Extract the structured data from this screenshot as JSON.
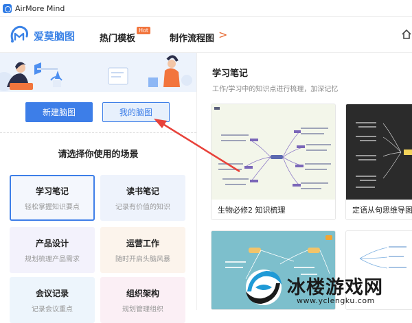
{
  "window": {
    "title": "AirMore Mind"
  },
  "header": {
    "brand": "爱莫脑图",
    "nav": [
      {
        "label": "热门模板",
        "badge": "Hot"
      },
      {
        "label": "制作流程图"
      }
    ],
    "next_arrow": ">"
  },
  "sidebar": {
    "new_button": "新建脑图",
    "mine_button": "我的脑图",
    "section_title": "请选择你使用的场景",
    "cards": [
      {
        "title": "学习笔记",
        "subtitle": "轻松掌握知识要点"
      },
      {
        "title": "读书笔记",
        "subtitle": "记录有价值的知识"
      },
      {
        "title": "产品设计",
        "subtitle": "规划梳理产品需求"
      },
      {
        "title": "运营工作",
        "subtitle": "随时开启头脑风暴"
      },
      {
        "title": "会议记录",
        "subtitle": "记录会议重点"
      },
      {
        "title": "组织架构",
        "subtitle": "规划管理组织"
      }
    ]
  },
  "main": {
    "title": "学习笔记",
    "subtitle": "工作/学习中的知识点进行梳理，加深记忆",
    "templates": [
      {
        "label": "生物必修2 知识梳理"
      },
      {
        "label": "定语从句思维导图"
      }
    ]
  },
  "watermark": {
    "text": "冰楼游戏网",
    "url": "www.yclengku.com"
  },
  "colors": {
    "accent": "#3d7ee8",
    "hot": "#f2753d",
    "annotation_arrow": "#e8423a"
  }
}
